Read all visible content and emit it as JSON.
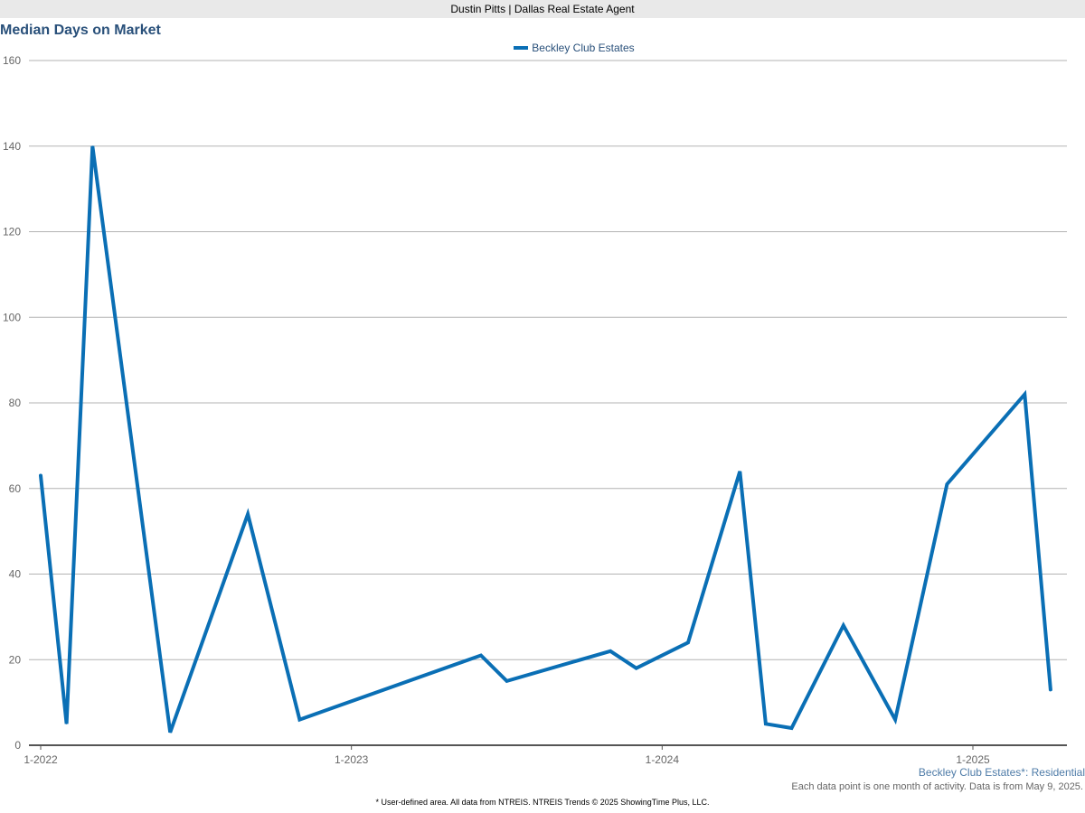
{
  "header": {
    "agent_label": "Dustin Pitts | Dallas Real Estate Agent"
  },
  "colors": {
    "series": "#0a6fb5",
    "grid": "#b3b3b3",
    "axis": "#555555",
    "title": "#29507a"
  },
  "chart_data": {
    "type": "line",
    "title": "Median Days on Market",
    "ylim": [
      0,
      160
    ],
    "yticks": [
      "0",
      "20",
      "40",
      "60",
      "80",
      "100",
      "120",
      "140",
      "160"
    ],
    "xtick_labels": [
      "1-2022",
      "1-2023",
      "1-2024",
      "1-2025"
    ],
    "xtick_months": [
      0,
      12,
      24,
      36
    ],
    "grid": true,
    "legend_position": "top-center",
    "series": [
      {
        "name": "Beckley Club Estates",
        "points": [
          {
            "month": "1-2022",
            "value": 63
          },
          {
            "month": "2-2022",
            "value": 5
          },
          {
            "month": "3-2022",
            "value": 140
          },
          {
            "month": "6-2022",
            "value": 3
          },
          {
            "month": "9-2022",
            "value": 54
          },
          {
            "month": "11-2022",
            "value": 6
          },
          {
            "month": "6-2023",
            "value": 21
          },
          {
            "month": "7-2023",
            "value": 15
          },
          {
            "month": "11-2023",
            "value": 22
          },
          {
            "month": "12-2023",
            "value": 18
          },
          {
            "month": "2-2024",
            "value": 24
          },
          {
            "month": "4-2024",
            "value": 64
          },
          {
            "month": "5-2024",
            "value": 5
          },
          {
            "month": "6-2024",
            "value": 4
          },
          {
            "month": "8-2024",
            "value": 28
          },
          {
            "month": "10-2024",
            "value": 6
          },
          {
            "month": "12-2024",
            "value": 61
          },
          {
            "month": "3-2025",
            "value": 82
          },
          {
            "month": "4-2025",
            "value": 13
          }
        ]
      }
    ]
  },
  "series_subtitle": "Beckley Club Estates*: Residential",
  "note": "Each data point is one month of activity. Data is from May 9, 2025.",
  "footer": "* User-defined area. All data from NTREIS. NTREIS Trends © 2025 ShowingTime Plus, LLC."
}
